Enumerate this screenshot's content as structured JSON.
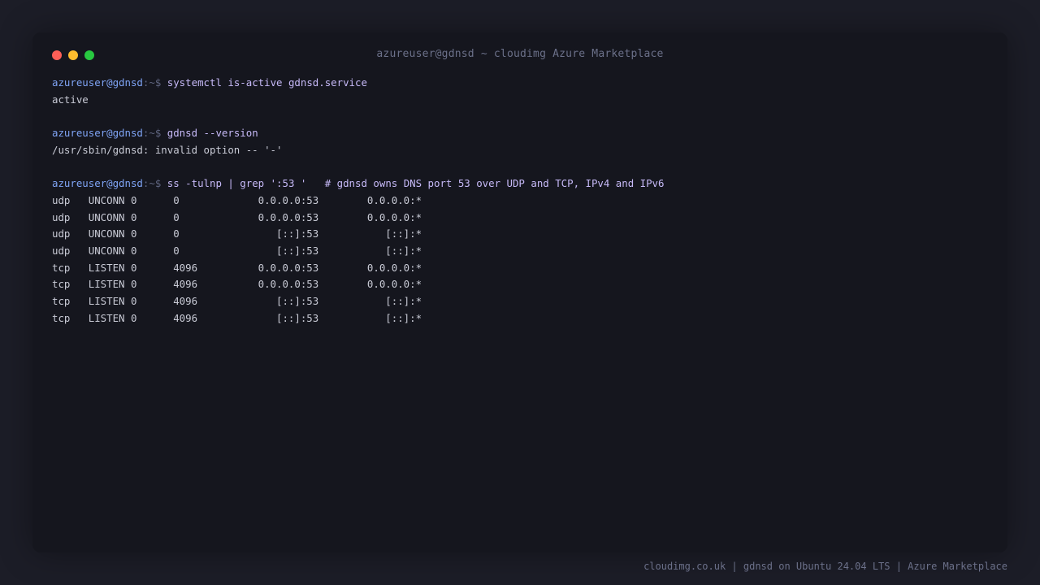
{
  "window": {
    "title": "azureuser@gdnsd ~ cloudimg Azure Marketplace",
    "traffic_lights": {
      "close_color": "#ff5f57",
      "minimize_color": "#febc2e",
      "maximize_color": "#28c840"
    }
  },
  "prompt": {
    "user_host": "azureuser@gdnsd",
    "path": ":~$"
  },
  "blocks": [
    {
      "command": "systemctl is-active gdnsd.service",
      "output": [
        "active"
      ]
    },
    {
      "command": "gdnsd --version",
      "output": [
        "/usr/sbin/gdnsd: invalid option -- '-'"
      ]
    },
    {
      "command": "ss -tulnp | grep ':53 '   # gdnsd owns DNS port 53 over UDP and TCP, IPv4 and IPv6",
      "output": [
        "udp   UNCONN 0      0             0.0.0.0:53        0.0.0.0:*",
        "udp   UNCONN 0      0             0.0.0.0:53        0.0.0.0:*",
        "udp   UNCONN 0      0                [::]:53           [::]:*",
        "udp   UNCONN 0      0                [::]:53           [::]:*",
        "tcp   LISTEN 0      4096          0.0.0.0:53        0.0.0.0:*",
        "tcp   LISTEN 0      4096          0.0.0.0:53        0.0.0.0:*",
        "tcp   LISTEN 0      4096             [::]:53           [::]:*",
        "tcp   LISTEN 0      4096             [::]:53           [::]:*"
      ]
    }
  ],
  "footer": {
    "text": "cloudimg.co.uk | gdnsd on Ubuntu 24.04 LTS | Azure Marketplace"
  }
}
